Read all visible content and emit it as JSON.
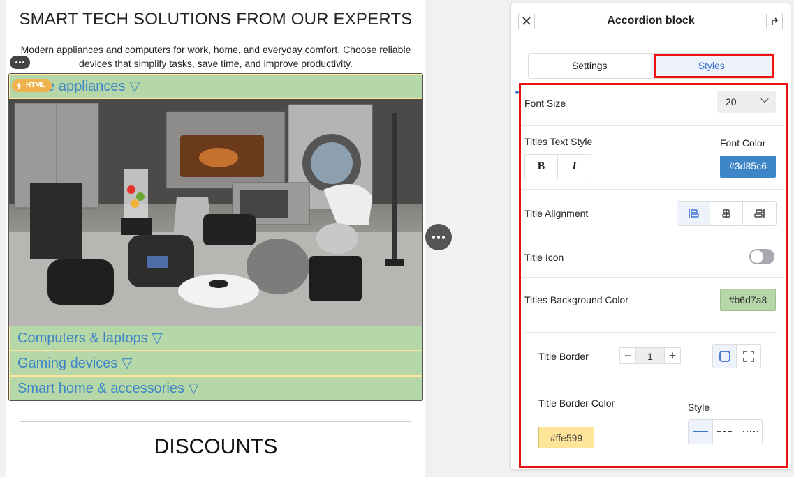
{
  "canvas": {
    "heading": "SMART TECH SOLUTIONS FROM OUR EXPERTS",
    "intro": "Modern appliances and computers for work, home, and everyday comfort. Choose reliable devices that simplify tasks, save time, and improve productivity.",
    "html_badge": "HTML",
    "accordion": [
      {
        "title": "Home appliances ▽"
      },
      {
        "title": "Computers & laptops ▽"
      },
      {
        "title": "Gaming devices ▽"
      },
      {
        "title": "Smart home & accessories ▽"
      }
    ],
    "discounts": "DISCOUNTS"
  },
  "panel": {
    "title": "Accordion block",
    "tabs": [
      "Settings",
      "Styles"
    ],
    "active_tab": "Styles",
    "font_size_label": "Font Size",
    "font_size_value": "20",
    "titles_text_style_label": "Titles Text Style",
    "bold_label": "B",
    "italic_label": "I",
    "font_color_label": "Font Color",
    "font_color_value": "#3d85c6",
    "title_alignment_label": "Title Alignment",
    "title_alignment_selected": "left",
    "title_icon_label": "Title Icon",
    "title_icon_enabled": false,
    "titles_bg_label": "Titles Background Color",
    "titles_bg_value": "#b6d7a8",
    "title_border_label": "Title Border",
    "title_border_width": "1",
    "title_border_color_label": "Title Border Color",
    "title_border_color_value": "#ffe599",
    "style_label": "Style",
    "border_style_selected": "solid"
  },
  "colors": {
    "accent": "#3d6fd0",
    "highlight": "#ee1111",
    "title_text": "#3d85c6",
    "title_bg": "#b6d7a8",
    "title_border": "#ffe599"
  }
}
